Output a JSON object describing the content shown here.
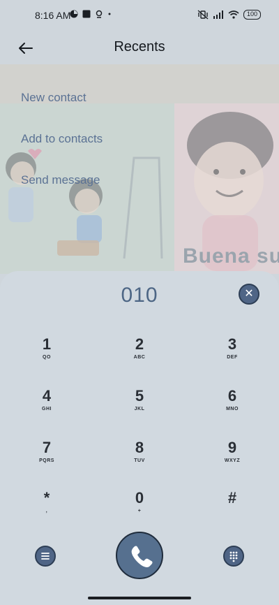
{
  "status_bar": {
    "time": "8:16 AM",
    "battery": "100",
    "left_icons": [
      "pie-icon",
      "square-icon",
      "location-icon",
      "dot-icon"
    ],
    "right_icons": [
      "vibrate-off-icon",
      "signal-icon",
      "wifi-icon",
      "battery-icon"
    ]
  },
  "header": {
    "title": "Recents",
    "back_icon": "arrow-left-icon"
  },
  "wallpaper": {
    "visible_text": "Buena su"
  },
  "menu": {
    "items": [
      {
        "label": "New contact"
      },
      {
        "label": "Add to contacts"
      },
      {
        "label": "Send message"
      }
    ]
  },
  "dialer": {
    "number": "010",
    "clear_icon": "close-icon",
    "keys": [
      {
        "digit": "1",
        "letters": "QO"
      },
      {
        "digit": "2",
        "letters": "ABC"
      },
      {
        "digit": "3",
        "letters": "DEF"
      },
      {
        "digit": "4",
        "letters": "GHI"
      },
      {
        "digit": "5",
        "letters": "JKL"
      },
      {
        "digit": "6",
        "letters": "MNO"
      },
      {
        "digit": "7",
        "letters": "PQRS"
      },
      {
        "digit": "8",
        "letters": "TUV"
      },
      {
        "digit": "9",
        "letters": "WXYZ"
      },
      {
        "digit": "*",
        "letters": ","
      },
      {
        "digit": "0",
        "letters": "+"
      },
      {
        "digit": "#",
        "letters": ""
      }
    ],
    "bottom_bar": {
      "menu_icon": "hamburger-menu-icon",
      "call_icon": "phone-icon",
      "keypad_icon": "dialpad-icon"
    }
  },
  "colors": {
    "accent": "#4f6586",
    "menu_text": "#5b7294",
    "number_text": "#4d6685",
    "panel_bg": "#d1d9e0"
  }
}
